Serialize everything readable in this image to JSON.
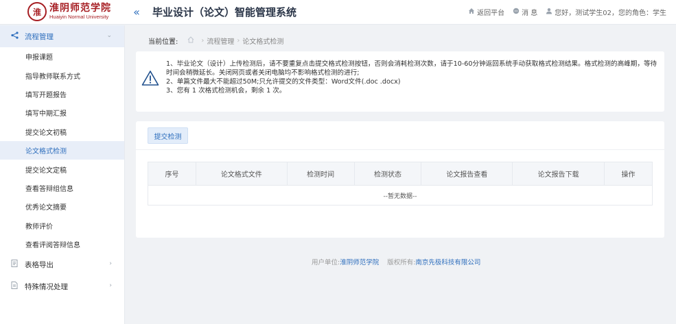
{
  "header": {
    "logo_cn": "淮阴师范学院",
    "logo_en": "Huaiyin Normal University",
    "seal_char": "淮",
    "collapse_icon": "«",
    "app_title": "毕业设计（论文）智能管理系统",
    "return_label": "返回平台",
    "messages_label": "消 息",
    "greeting": "您好，测试学生02，您的角色：学生"
  },
  "sidebar": {
    "groups": [
      {
        "label": "流程管理",
        "icon": "share-icon",
        "open": true,
        "items": [
          {
            "label": "申报课题"
          },
          {
            "label": "指导教师联系方式"
          },
          {
            "label": "填写开题报告"
          },
          {
            "label": "填写中期汇报"
          },
          {
            "label": "提交论文初稿"
          },
          {
            "label": "论文格式检测",
            "active": true
          },
          {
            "label": "提交论文定稿"
          },
          {
            "label": "查看答辩组信息"
          },
          {
            "label": "优秀论文摘要"
          },
          {
            "label": "教师评价"
          },
          {
            "label": "查看评阅答辩信息"
          }
        ]
      },
      {
        "label": "表格导出",
        "icon": "document-icon",
        "open": false
      },
      {
        "label": "特殊情况处理",
        "icon": "file-icon",
        "open": false
      }
    ]
  },
  "breadcrumb": {
    "prefix": "当前位置:",
    "parent": "流程管理",
    "current": "论文格式检测",
    "separator": "›"
  },
  "notice": {
    "lines": [
      "1、毕业论文（设计）上传检测后，请不要重复点击提交格式检测按钮，否则会消耗检测次数，请于10-60分钟返回系统手动获取格式检测结果。格式检测的高峰期，等待",
      "时间会稍微延长。关闭网页或者关闭电脑均不影响格式检测的进行;",
      "2、单篇文件最大不能超过50M;只允许提交的文件类型：Word文件(.doc .docx)",
      "3、您有 1 次格式检测机会，剩余 1 次。"
    ]
  },
  "panel": {
    "submit_label": "提交检测",
    "columns": [
      "序号",
      "论文格式文件",
      "检测时间",
      "检测状态",
      "论文报告查看",
      "论文报告下载",
      "操作"
    ],
    "empty_text": "--暂无数据--"
  },
  "footer": {
    "unit_label": "用户单位:",
    "unit_value": "淮阴师范学院",
    "copyright_label": "版权所有:",
    "copyright_value": "南京先极科技有限公司"
  },
  "colors": {
    "accent": "#2f6fbd",
    "brand_red": "#a61d22",
    "warning": "#1e4f8c"
  }
}
